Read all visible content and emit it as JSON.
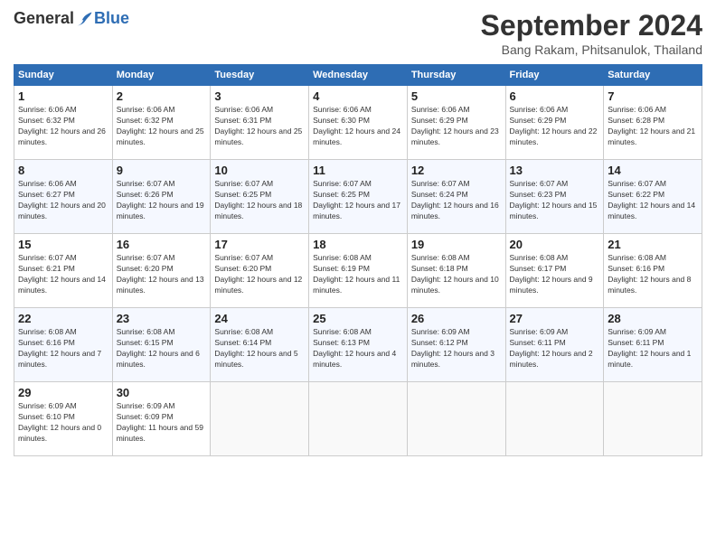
{
  "logo": {
    "general": "General",
    "blue": "Blue"
  },
  "title": "September 2024",
  "subtitle": "Bang Rakam, Phitsanulok, Thailand",
  "days_of_week": [
    "Sunday",
    "Monday",
    "Tuesday",
    "Wednesday",
    "Thursday",
    "Friday",
    "Saturday"
  ],
  "weeks": [
    [
      {
        "day": "1",
        "sunrise": "6:06 AM",
        "sunset": "6:32 PM",
        "daylight": "12 hours and 26 minutes."
      },
      {
        "day": "2",
        "sunrise": "6:06 AM",
        "sunset": "6:32 PM",
        "daylight": "12 hours and 25 minutes."
      },
      {
        "day": "3",
        "sunrise": "6:06 AM",
        "sunset": "6:31 PM",
        "daylight": "12 hours and 25 minutes."
      },
      {
        "day": "4",
        "sunrise": "6:06 AM",
        "sunset": "6:30 PM",
        "daylight": "12 hours and 24 minutes."
      },
      {
        "day": "5",
        "sunrise": "6:06 AM",
        "sunset": "6:29 PM",
        "daylight": "12 hours and 23 minutes."
      },
      {
        "day": "6",
        "sunrise": "6:06 AM",
        "sunset": "6:29 PM",
        "daylight": "12 hours and 22 minutes."
      },
      {
        "day": "7",
        "sunrise": "6:06 AM",
        "sunset": "6:28 PM",
        "daylight": "12 hours and 21 minutes."
      }
    ],
    [
      {
        "day": "8",
        "sunrise": "6:06 AM",
        "sunset": "6:27 PM",
        "daylight": "12 hours and 20 minutes."
      },
      {
        "day": "9",
        "sunrise": "6:07 AM",
        "sunset": "6:26 PM",
        "daylight": "12 hours and 19 minutes."
      },
      {
        "day": "10",
        "sunrise": "6:07 AM",
        "sunset": "6:25 PM",
        "daylight": "12 hours and 18 minutes."
      },
      {
        "day": "11",
        "sunrise": "6:07 AM",
        "sunset": "6:25 PM",
        "daylight": "12 hours and 17 minutes."
      },
      {
        "day": "12",
        "sunrise": "6:07 AM",
        "sunset": "6:24 PM",
        "daylight": "12 hours and 16 minutes."
      },
      {
        "day": "13",
        "sunrise": "6:07 AM",
        "sunset": "6:23 PM",
        "daylight": "12 hours and 15 minutes."
      },
      {
        "day": "14",
        "sunrise": "6:07 AM",
        "sunset": "6:22 PM",
        "daylight": "12 hours and 14 minutes."
      }
    ],
    [
      {
        "day": "15",
        "sunrise": "6:07 AM",
        "sunset": "6:21 PM",
        "daylight": "12 hours and 14 minutes."
      },
      {
        "day": "16",
        "sunrise": "6:07 AM",
        "sunset": "6:20 PM",
        "daylight": "12 hours and 13 minutes."
      },
      {
        "day": "17",
        "sunrise": "6:07 AM",
        "sunset": "6:20 PM",
        "daylight": "12 hours and 12 minutes."
      },
      {
        "day": "18",
        "sunrise": "6:08 AM",
        "sunset": "6:19 PM",
        "daylight": "12 hours and 11 minutes."
      },
      {
        "day": "19",
        "sunrise": "6:08 AM",
        "sunset": "6:18 PM",
        "daylight": "12 hours and 10 minutes."
      },
      {
        "day": "20",
        "sunrise": "6:08 AM",
        "sunset": "6:17 PM",
        "daylight": "12 hours and 9 minutes."
      },
      {
        "day": "21",
        "sunrise": "6:08 AM",
        "sunset": "6:16 PM",
        "daylight": "12 hours and 8 minutes."
      }
    ],
    [
      {
        "day": "22",
        "sunrise": "6:08 AM",
        "sunset": "6:16 PM",
        "daylight": "12 hours and 7 minutes."
      },
      {
        "day": "23",
        "sunrise": "6:08 AM",
        "sunset": "6:15 PM",
        "daylight": "12 hours and 6 minutes."
      },
      {
        "day": "24",
        "sunrise": "6:08 AM",
        "sunset": "6:14 PM",
        "daylight": "12 hours and 5 minutes."
      },
      {
        "day": "25",
        "sunrise": "6:08 AM",
        "sunset": "6:13 PM",
        "daylight": "12 hours and 4 minutes."
      },
      {
        "day": "26",
        "sunrise": "6:09 AM",
        "sunset": "6:12 PM",
        "daylight": "12 hours and 3 minutes."
      },
      {
        "day": "27",
        "sunrise": "6:09 AM",
        "sunset": "6:11 PM",
        "daylight": "12 hours and 2 minutes."
      },
      {
        "day": "28",
        "sunrise": "6:09 AM",
        "sunset": "6:11 PM",
        "daylight": "12 hours and 1 minute."
      }
    ],
    [
      {
        "day": "29",
        "sunrise": "6:09 AM",
        "sunset": "6:10 PM",
        "daylight": "12 hours and 0 minutes."
      },
      {
        "day": "30",
        "sunrise": "6:09 AM",
        "sunset": "6:09 PM",
        "daylight": "11 hours and 59 minutes."
      },
      null,
      null,
      null,
      null,
      null
    ]
  ]
}
